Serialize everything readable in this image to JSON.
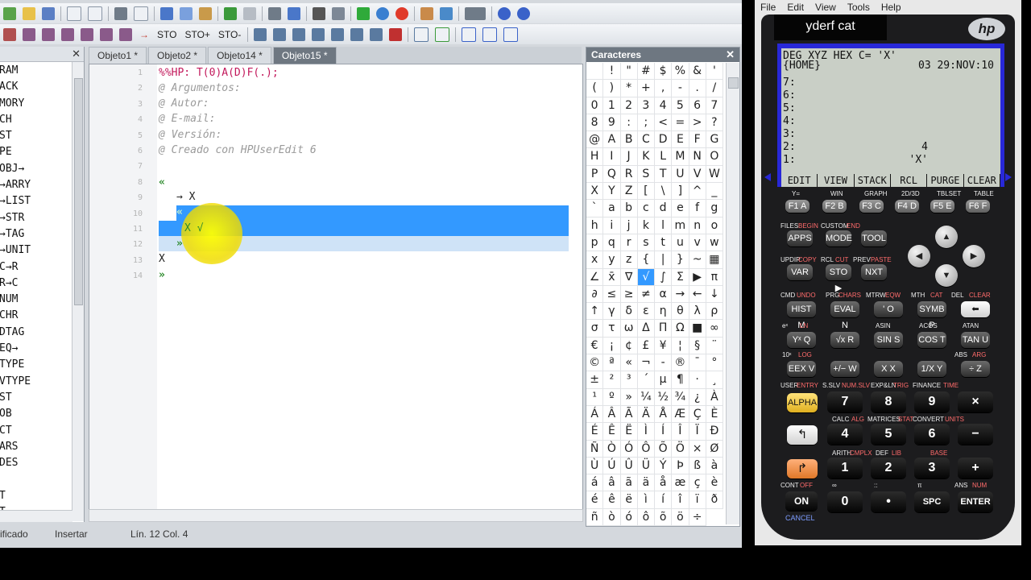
{
  "toolbar2": {
    "sto1": "STO",
    "sto2": "STO+",
    "sto3": "STO-"
  },
  "cmd_panel": {
    "items": [
      "RAM",
      "ACK",
      "MORY",
      "CH",
      "ST",
      "PE",
      "OBJ→",
      "→ARRY",
      "→LIST",
      "→STR",
      "→TAG",
      "→UNIT",
      "C→R",
      "R→C",
      "NUM",
      "CHR",
      "DTAG",
      "EQ→",
      "TYPE",
      "VTYPE",
      "ST",
      "OB",
      "CT",
      "ARS",
      "DES",
      "",
      "T",
      "T"
    ]
  },
  "tabs": [
    "Objeto1 *",
    "Objeto2 *",
    "Objeto14 *",
    "Objeto15 *"
  ],
  "code": {
    "line_numbers": [
      "1",
      "2",
      "3",
      "4",
      "5",
      "6",
      "7",
      "8",
      "9",
      "10",
      "11",
      "12",
      "13",
      "14"
    ],
    "l1": "%%HP: T(0)A(D)F(.);",
    "l2": "@ Argumentos:",
    "l3": "@ Autor:",
    "l4": "@ E-mail:",
    "l5": "@ Versión:",
    "l6": "@ Creado con HPUserEdit 6",
    "l8": "«",
    "l9": "→ X",
    "l10": "«",
    "l11": "X √",
    "l12": "»",
    "l13": "X",
    "l14": "»"
  },
  "status": {
    "modified": "ificado",
    "mode": "Insertar",
    "position": "Lín. 12  Col. 4"
  },
  "chars_panel": {
    "title": "Caracteres",
    "selected": "√",
    "chars": [
      " ",
      "!",
      "\"",
      "#",
      "$",
      "%",
      "&",
      "'",
      "(",
      ")",
      "*",
      "+",
      ",",
      "-",
      ".",
      "/",
      "0",
      "1",
      "2",
      "3",
      "4",
      "5",
      "6",
      "7",
      "8",
      "9",
      ":",
      ";",
      "<",
      "=",
      ">",
      "?",
      "@",
      "A",
      "B",
      "C",
      "D",
      "E",
      "F",
      "G",
      "H",
      "I",
      "J",
      "K",
      "L",
      "M",
      "N",
      "O",
      "P",
      "Q",
      "R",
      "S",
      "T",
      "U",
      "V",
      "W",
      "X",
      "Y",
      "Z",
      "[",
      "\\",
      "]",
      "^",
      "_",
      "`",
      "a",
      "b",
      "c",
      "d",
      "e",
      "f",
      "g",
      "h",
      "i",
      "j",
      "k",
      "l",
      "m",
      "n",
      "o",
      "p",
      "q",
      "r",
      "s",
      "t",
      "u",
      "v",
      "w",
      "x",
      "y",
      "z",
      "{",
      "|",
      "}",
      "~",
      "▦",
      "∠",
      "x̄",
      "∇",
      "√",
      "∫",
      "Σ",
      "▶",
      "π",
      "∂",
      "≤",
      "≥",
      "≠",
      "α",
      "→",
      "←",
      "↓",
      "↑",
      "γ",
      "δ",
      "ε",
      "η",
      "θ",
      "λ",
      "ρ",
      "σ",
      "τ",
      "ω",
      "Δ",
      "Π",
      "Ω",
      "■",
      "∞",
      "€",
      "¡",
      "¢",
      "£",
      "¥",
      "¦",
      "§",
      "¨",
      "©",
      "ª",
      "«",
      "¬",
      "-",
      "®",
      "¯",
      "°",
      "±",
      "²",
      "³",
      "´",
      "µ",
      "¶",
      "·",
      "¸",
      "¹",
      "º",
      "»",
      "¼",
      "½",
      "¾",
      "¿",
      "À",
      "Á",
      "Â",
      "Ã",
      "Ä",
      "Å",
      "Æ",
      "Ç",
      "È",
      "É",
      "Ê",
      "Ë",
      "Ì",
      "Í",
      "Î",
      "Ï",
      "Ð",
      "Ñ",
      "Ò",
      "Ó",
      "Ô",
      "Õ",
      "Ö",
      "×",
      "Ø",
      "Ù",
      "Ú",
      "Û",
      "Ü",
      "Ý",
      "Þ",
      "ß",
      "à",
      "á",
      "â",
      "ã",
      "ä",
      "å",
      "æ",
      "ç",
      "è",
      "é",
      "ê",
      "ë",
      "ì",
      "í",
      "î",
      "ï",
      "ð",
      "ñ",
      "ò",
      "ó",
      "ô",
      "õ",
      "ö",
      "÷"
    ]
  },
  "calculator": {
    "menu": [
      "File",
      "Edit",
      "View",
      "Tools",
      "Help"
    ],
    "title": "yderf cat",
    "logo": "hp",
    "lcd_header": "DEG XYZ HEX C= 'X'",
    "lcd_home": "{HOME}",
    "lcd_date": "03 29:NOV:10",
    "stack": [
      "7:",
      "6:",
      "5:",
      "4:",
      "3:",
      "2:                    4",
      "1:                  'X'"
    ],
    "softkeys": [
      "EDIT",
      "VIEW",
      "STACK",
      "RCL",
      "PURGE",
      "CLEAR"
    ],
    "fkey_top": [
      "Y=",
      "WIN",
      "GRAPH",
      "2D/3D",
      "TBLSET",
      "TABLE"
    ],
    "fkeys": [
      "F1 A",
      "F2 B",
      "F3 C",
      "F4 D",
      "F5 E",
      "F6 F"
    ],
    "row1_labels": [
      "FILES",
      "BEGIN",
      "CUSTOM",
      "END"
    ],
    "apps": "APPS",
    "mode": "MODE",
    "tool": "TOOL",
    "row2_labels": [
      "UPDIR",
      "COPY",
      "RCL",
      "CUT",
      "PREV",
      "PASTE"
    ],
    "var": "VAR",
    "sto": "STO ▶",
    "nxt": "NXT",
    "row3_labels": [
      "CMD",
      "UNDO",
      "PRG",
      "CHARS",
      "MTRW",
      "EQW",
      "MTH",
      "CAT",
      "DEL",
      "CLEAR"
    ],
    "hist": "HIST M",
    "eval": "EVAL N",
    "quote": "' O",
    "symb": "SYMB P",
    "back": "⬅",
    "row4_labels": [
      "eˣ",
      "LN",
      "ASIN",
      "ACOS",
      "ATAN"
    ],
    "yx": "Yˣ Q",
    "sqrt": "√x R",
    "sin": "SIN S",
    "cos": "COS T",
    "tan": "TAN U",
    "row5_labels": [
      "10ˣ",
      "LOG",
      "ABS",
      "ARG"
    ],
    "eex": "EEX V",
    "neg": "+/− W",
    "x": "X X",
    "inv": "1/X Y",
    "div": "÷ Z",
    "row6_labels": [
      "USER",
      "ENTRY",
      "S.SLV",
      "NUM.SLV",
      "EXP&LN",
      "TRIG",
      "FINANCE",
      "TIME"
    ],
    "alpha": "ALPHA",
    "d7": "7",
    "d8": "8",
    "d9": "9",
    "mul": "×",
    "row7_labels": [
      "CALC",
      "ALG",
      "MATRICES",
      "STAT",
      "CONVERT",
      "UNITS"
    ],
    "left_shift": "↰",
    "d4": "4",
    "d5": "5",
    "d6": "6",
    "minus": "−",
    "row8_labels": [
      "ARITH",
      "CMPLX",
      "DEF",
      "LIB",
      "BASE"
    ],
    "right_shift": "↱",
    "d1": "1",
    "d2": "2",
    "d3": "3",
    "plus": "+",
    "row9_labels": [
      "CONT",
      "OFF",
      "∞",
      "::",
      "π",
      "ANS",
      "NUM"
    ],
    "on": "ON",
    "d0": "0",
    "dot": "•",
    "spc": "SPC",
    "enter": "ENTER",
    "cancel": "CANCEL"
  }
}
